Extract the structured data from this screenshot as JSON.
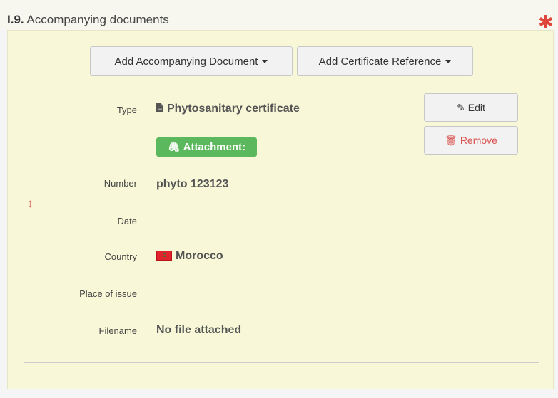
{
  "section": {
    "number": "I.9.",
    "title": "Accompanying documents",
    "required_mark": "✱"
  },
  "toolbar": {
    "add_document_label": "Add Accompanying Document",
    "add_certificate_label": "Add Certificate Reference"
  },
  "document": {
    "type_label": "Type",
    "type_value": "Phytosanitary certificate",
    "attachment_badge": "Attachment:",
    "number_label": "Number",
    "number_value": "phyto 123123",
    "date_label": "Date",
    "date_value": "",
    "country_label": "Country",
    "country_value": "Morocco",
    "place_label": "Place of issue",
    "place_value": "",
    "filename_label": "Filename",
    "filename_value": "No file attached"
  },
  "actions": {
    "edit_label": "Edit",
    "remove_label": "Remove"
  },
  "icons": {
    "document": "file-text-icon",
    "attachment": "paperclip-icon",
    "edit": "edit-icon",
    "remove": "trash-icon",
    "resize": "resize-vertical-icon",
    "flag": "morocco-flag-icon"
  },
  "colors": {
    "panel_bg": "#f8f8d8",
    "badge_green": "#5cb85c",
    "remove_red": "#d9534f",
    "required_red": "#e0453a"
  }
}
